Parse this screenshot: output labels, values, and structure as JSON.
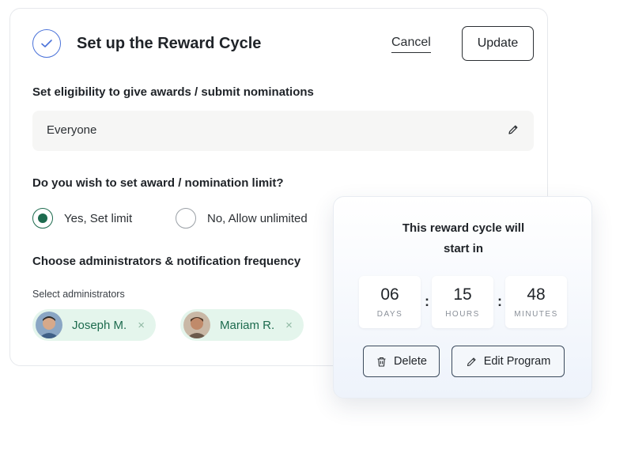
{
  "header": {
    "title": "Set up the Reward Cycle",
    "cancel_label": "Cancel",
    "update_label": "Update"
  },
  "eligibility": {
    "label": "Set eligibility to give awards / submit nominations",
    "value": "Everyone"
  },
  "limit": {
    "question": "Do you wish to set award / nomination limit?",
    "options": [
      {
        "label": "Yes, Set limit",
        "selected": true
      },
      {
        "label": "No, Allow unlimited",
        "selected": false
      }
    ]
  },
  "admins": {
    "heading": "Choose administrators & notification frequency",
    "select_label": "Select administrators",
    "chips": [
      {
        "name": "Joseph M.",
        "remove": "×"
      },
      {
        "name": "Mariam R.",
        "remove": "×"
      }
    ]
  },
  "countdown": {
    "title_line1": "This reward cycle will",
    "title_line2": "start in",
    "days": "06",
    "days_label": "DAYS",
    "hours": "15",
    "hours_label": "HOURS",
    "minutes": "48",
    "minutes_label": "MINUTES",
    "separator": ":",
    "delete_label": "Delete",
    "edit_label": "Edit Program"
  },
  "colors": {
    "accent_green": "#1d6b4e",
    "chip_bg": "#e4f5ec",
    "check_blue": "#4a72d9"
  }
}
